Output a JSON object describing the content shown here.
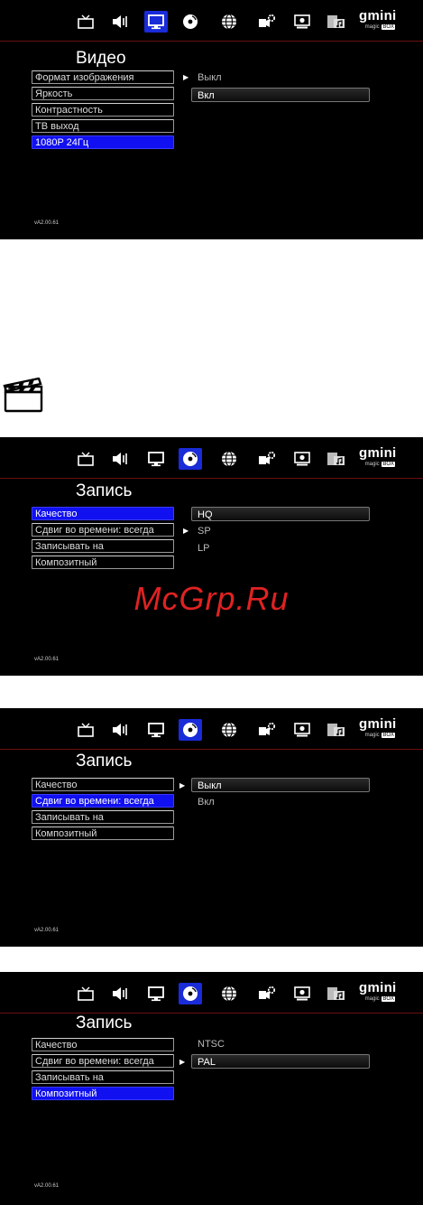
{
  "brand": {
    "name": "gmini",
    "sub": "magic",
    "sub_box": "BOX"
  },
  "icons": [
    "tv-icon",
    "speaker-icon",
    "monitor-icon",
    "record-disc-icon",
    "globe-icon",
    "gear-camera-icon",
    "system-screen-icon",
    "photo-music-icon"
  ],
  "screens": [
    {
      "title": "Видео",
      "selected_icon": 2,
      "menu": [
        {
          "label": "Формат изображения"
        },
        {
          "label": "Яркость"
        },
        {
          "label": "Контрастность"
        },
        {
          "label": "ТВ выход"
        },
        {
          "label": "1080P 24Гц",
          "active": true
        }
      ],
      "options": [
        {
          "label": "Выкл",
          "arrow": true
        },
        {
          "label": "Вкл",
          "highlighted": true
        }
      ],
      "version": "vA2.00.61"
    },
    {
      "title": "Запись",
      "selected_icon": 3,
      "menu": [
        {
          "label": "Качество",
          "active": true
        },
        {
          "label": "Сдвиг во времени: всегда"
        },
        {
          "label": "Записывать на"
        },
        {
          "label": "Композитный"
        }
      ],
      "options": [
        {
          "label": "HQ",
          "highlighted": true
        },
        {
          "label": "SP",
          "arrow": true
        },
        {
          "label": "LP"
        }
      ],
      "version": "vA2.00.61"
    },
    {
      "title": "Запись",
      "selected_icon": 3,
      "menu": [
        {
          "label": "Качество"
        },
        {
          "label": "Сдвиг во времени: всегда",
          "active": true
        },
        {
          "label": "Записывать на"
        },
        {
          "label": "Композитный"
        }
      ],
      "options": [
        {
          "label": "Выкл",
          "arrow": true,
          "highlighted": true
        },
        {
          "label": "Вкл"
        }
      ],
      "version": "vA2.00.61"
    },
    {
      "title": "Запись",
      "selected_icon": 3,
      "menu": [
        {
          "label": "Качество"
        },
        {
          "label": "Сдвиг во времени: всегда"
        },
        {
          "label": "Записывать на"
        },
        {
          "label": "Композитный",
          "active": true
        }
      ],
      "options": [
        {
          "label": "NTSC"
        },
        {
          "label": "PAL",
          "arrow": true,
          "highlighted": true
        }
      ],
      "version": "vA2.00.61"
    }
  ],
  "clapperboard_icon": "clapperboard-icon",
  "watermark": "McGrp.Ru",
  "colors": {
    "selection": "#1010f0",
    "icon_selected": "#1a2bd8",
    "divider": "#6a1010",
    "watermark": "#e02222"
  }
}
